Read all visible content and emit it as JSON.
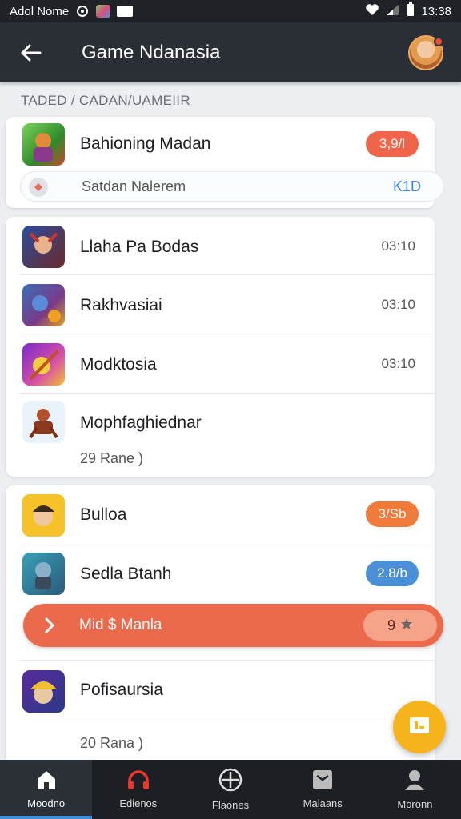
{
  "status_bar": {
    "carrier": "Adol Nome",
    "time": "13:38"
  },
  "app_bar": {
    "title": "Game Ndanasia"
  },
  "section_label": "TADED / CADAN/UAMEIIR",
  "featured": {
    "title": "Bahioning Madan",
    "badge": "3,9/l",
    "badge_color": "#f0654a",
    "sub_label": "Satdan Nalerem",
    "sub_value": "K1D"
  },
  "list1": [
    {
      "title": "Llaha Pa Bodas",
      "time": "03:10"
    },
    {
      "title": "Rakhvasiai",
      "time": "03:10"
    },
    {
      "title": "Modktosia",
      "time": "03:10"
    },
    {
      "title": "Mophfaghiednar",
      "time": ""
    }
  ],
  "list1_more": "29 Rane )",
  "list2": [
    {
      "title": "Bulloa",
      "badge": "3/Sb",
      "badge_color": "#f07a3a"
    },
    {
      "title": "Sedla Btanh",
      "badge": "2.8/b",
      "badge_color": "#4a90d9"
    }
  ],
  "highlight": {
    "label": "Mid $ Manla",
    "count": "9",
    "color": "#ec6a4c"
  },
  "list2_last": {
    "title": "Pofisaursia"
  },
  "list2_more": "20 Rana )",
  "bottom_nav": [
    {
      "label": "Moodno",
      "icon": "home-icon"
    },
    {
      "label": "Edienos",
      "icon": "headphones-icon"
    },
    {
      "label": "Flaones",
      "icon": "plus-circle-icon"
    },
    {
      "label": "Malaans",
      "icon": "inbox-icon"
    },
    {
      "label": "Moronn",
      "icon": "profile-icon"
    }
  ]
}
